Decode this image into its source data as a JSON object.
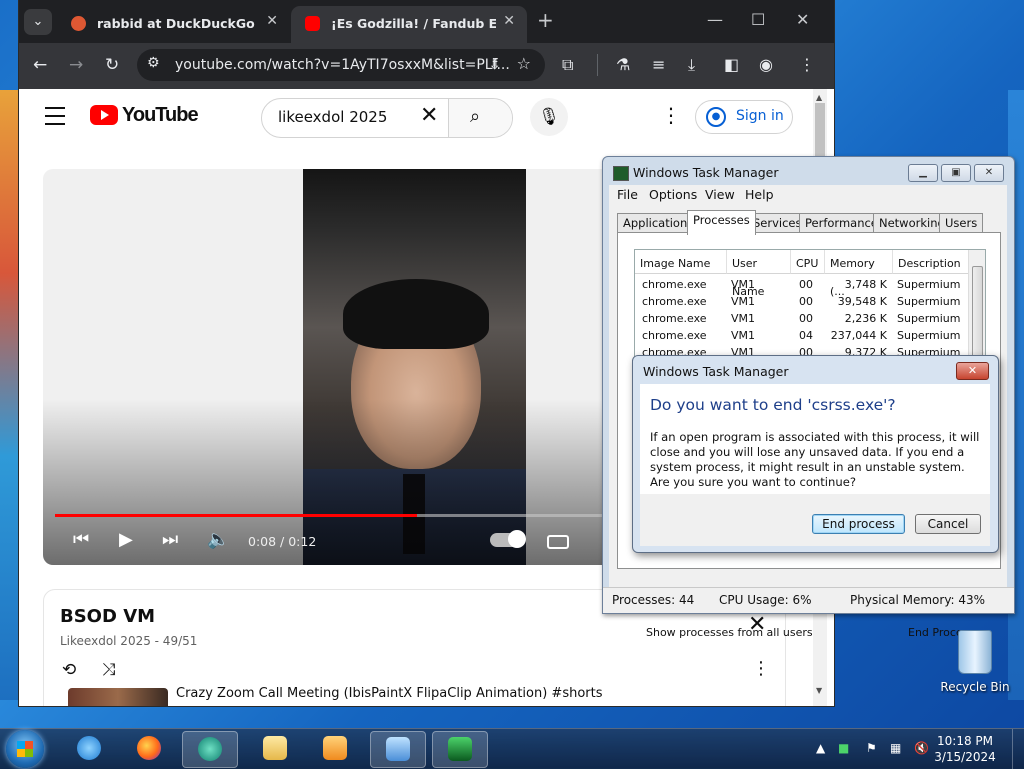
{
  "browser": {
    "tabs": [
      {
        "title": "rabbid at DuckDuckGo",
        "close": "✕",
        "favicon_color": "#de5833"
      },
      {
        "title": "¡Es Godzilla! / Fandub Español",
        "close": "✕",
        "favicon_color": "#ff0000"
      }
    ],
    "new_tab": "+",
    "window_controls": {
      "minimize": "—",
      "maximize": "☐",
      "close": "✕"
    },
    "url": "youtube.com/watch?v=1AyTI7osxxM&list=PLf..."
  },
  "youtube": {
    "logo_text": "YouTube",
    "search_query": "likeexdol 2025",
    "clear": "✕",
    "sign_in": "Sign in",
    "player": {
      "time": "0:08 / 0:12",
      "progress": 0.66
    },
    "playlist": {
      "title": "BSOD VM",
      "subtitle": "Likeexdol 2025 - 49/51",
      "close": "✕",
      "item_title": "Crazy Zoom Call Meeting (IbisPaintX FlipaClip Animation) #shorts"
    }
  },
  "task_manager": {
    "title": "Windows Task Manager",
    "menu": [
      "File",
      "Options",
      "View",
      "Help"
    ],
    "tabs": [
      "Applications",
      "Processes",
      "Services",
      "Performance",
      "Networking",
      "Users"
    ],
    "selected_tab": "Processes",
    "columns": [
      "Image Name",
      "User Name",
      "CPU",
      "Memory (...",
      "Description"
    ],
    "rows": [
      {
        "name": "chrome.exe",
        "user": "VM1",
        "cpu": "00",
        "mem": "3,748 K",
        "desc": "Supermium"
      },
      {
        "name": "chrome.exe",
        "user": "VM1",
        "cpu": "00",
        "mem": "39,548 K",
        "desc": "Supermium"
      },
      {
        "name": "chrome.exe",
        "user": "VM1",
        "cpu": "00",
        "mem": "2,236 K",
        "desc": "Supermium"
      },
      {
        "name": "chrome.exe",
        "user": "VM1",
        "cpu": "04",
        "mem": "237,044 K",
        "desc": "Supermium"
      },
      {
        "name": "chrome.exe",
        "user": "VM1",
        "cpu": "00",
        "mem": "9,372 K",
        "desc": "Supermium"
      }
    ],
    "show_all_label": "Show processes from all users",
    "end_process_label": "End Process",
    "status": {
      "processes": "Processes: 44",
      "cpu": "CPU Usage: 6%",
      "memory": "Physical Memory: 43%"
    }
  },
  "dialog": {
    "title": "Windows Task Manager",
    "close": "✕",
    "question": "Do you want to end 'csrss.exe'?",
    "text": "If an open program is associated with this process, it will close and you will lose any unsaved data. If you end a system process, it might result in an unstable system. Are you sure you want to continue?",
    "confirm": "End process",
    "cancel": "Cancel"
  },
  "desktop": {
    "recycle_bin": "Recycle Bin"
  },
  "taskbar": {
    "time": "10:18 PM",
    "date": "3/15/2024"
  }
}
